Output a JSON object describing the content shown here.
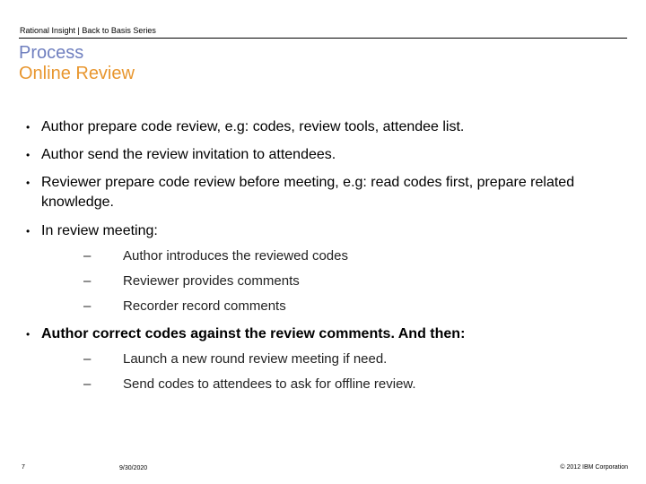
{
  "header": {
    "series": "Rational Insight | Back to Basis Series"
  },
  "title": {
    "line1": "Process",
    "line2": "Online Review"
  },
  "bullets": [
    {
      "text": "Author prepare code review, e.g: codes, review tools, attendee list."
    },
    {
      "text": "Author send the review invitation to attendees."
    },
    {
      "text": "Reviewer prepare code review before meeting, e.g: read codes first, prepare related knowledge."
    },
    {
      "text": "In review meeting:",
      "subitems": [
        "Author introduces the reviewed codes",
        "Reviewer provides comments",
        "Recorder record comments"
      ]
    },
    {
      "text": "Author correct codes against the review comments. And then:",
      "subitems": [
        "Launch a new round review meeting if need.",
        "Send codes to attendees to ask for offline review."
      ]
    }
  ],
  "bullet_glyph": "•",
  "sub_glyph": "–",
  "footer": {
    "page": "7",
    "date": "9/30/2020",
    "copyright": "© 2012 IBM Corporation"
  },
  "colors": {
    "title1": "#6f7fbf",
    "title2": "#e8962e"
  }
}
